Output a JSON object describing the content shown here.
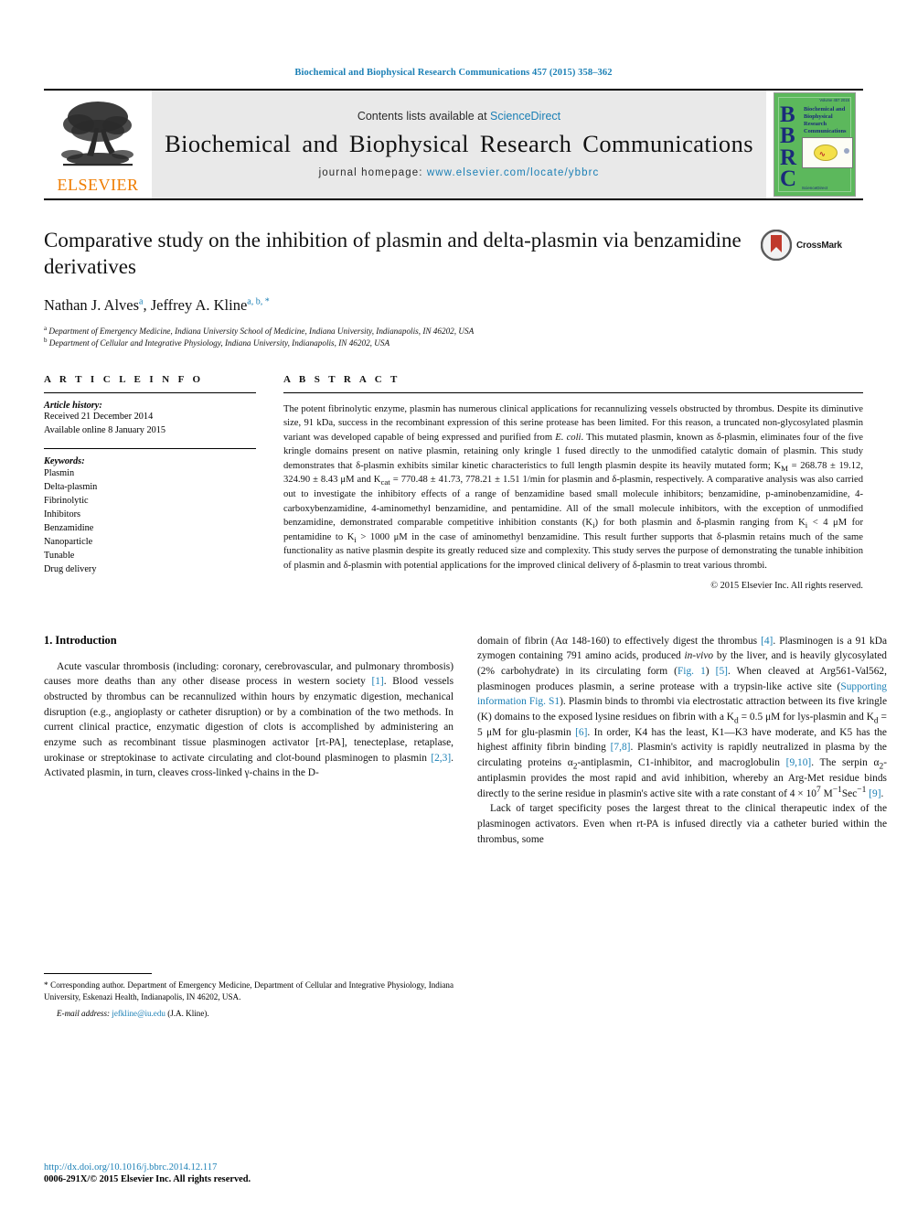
{
  "running_head": "Biochemical and Biophysical Research Communications 457 (2015) 358–362",
  "masthead": {
    "contents_prefix": "Contents lists available at ",
    "sciencedirect": "ScienceDirect",
    "journal_title": "Biochemical and Biophysical Research Communications",
    "homepage_prefix": "journal homepage: ",
    "homepage_url": "www.elsevier.com/locate/ybbrc",
    "publisher": "ELSEVIER",
    "publisher_logo_icon": "elsevier-tree-icon"
  },
  "cover": {
    "letters": "BBRC",
    "journal_name": "Biochemical and Biophysical Research Communications",
    "top_text": "Volume 457  2015",
    "bottom_text": "ScienceDirect"
  },
  "title_block": {
    "title": "Comparative study on the inhibition of plasmin and delta-plasmin via benzamidine derivatives",
    "author_1": "Nathan J. Alves",
    "author_1_marks": "a",
    "author_2": "Jeffrey A. Kline",
    "author_2_marks": "a, b, *",
    "affiliation_a": "Department of Emergency Medicine, Indiana University School of Medicine, Indiana University, Indianapolis, IN 46202, USA",
    "affiliation_b": "Department of Cellular and Integrative Physiology, Indiana University, Indianapolis, IN 46202, USA",
    "crossmark_label": "CrossMark",
    "crossmark_icon": "crossmark-icon"
  },
  "article_info": {
    "heading": "A R T I C L E  I N F O",
    "history_label": "Article history:",
    "received": "Received 21 December 2014",
    "available_online": "Available online 8 January 2015",
    "keywords_label": "Keywords:",
    "keywords": [
      "Plasmin",
      "Delta-plasmin",
      "Fibrinolytic",
      "Inhibitors",
      "Benzamidine",
      "Nanoparticle",
      "Tunable",
      "Drug delivery"
    ]
  },
  "abstract": {
    "heading": "A B S T R A C T",
    "body_1": "The potent fibrinolytic enzyme, plasmin has numerous clinical applications for recannulizing vessels obstructed by thrombus. Despite its diminutive size, 91 kDa, success in the recombinant expression of this serine protease has been limited. For this reason, a truncated non-glycosylated plasmin variant was developed capable of being expressed and purified from ",
    "ecoli": "E. coli",
    "body_2": ". This mutated plasmin, known as δ-plasmin, eliminates four of the five kringle domains present on native plasmin, retaining only kringle 1 fused directly to the unmodified catalytic domain of plasmin. This study demonstrates that δ-plasmin exhibits similar kinetic characteristics to full length plasmin despite its heavily mutated form; K",
    "km_sub": "M",
    "body_3": " = 268.78 ± 19.12, 324.90 ± 8.43 μM and K",
    "kcat_sub": "cat",
    "body_4": " = 770.48 ± 41.73, 778.21 ± 1.51 1/min for plasmin and δ-plasmin, respectively. A comparative analysis was also carried out to investigate the inhibitory effects of a range of benzamidine based small molecule inhibitors; benzamidine, p-aminobenzamidine, 4-carboxybenzamidine, 4-aminomethyl benzamidine, and pentamidine. All of the small molecule inhibitors, with the exception of unmodified benzamidine, demonstrated comparable competitive inhibition constants (K",
    "ki_sub_1": "i",
    "body_5": ") for both plasmin and δ-plasmin ranging from K",
    "ki_sub_2": "i",
    "body_6": " < 4 μM for pentamidine to K",
    "ki_sub_3": "i",
    "body_7": " > 1000 μM in the case of aminomethyl benzamidine. This result further supports that δ-plasmin retains much of the same functionality as native plasmin despite its greatly reduced size and complexity. This study serves the purpose of demonstrating the tunable inhibition of plasmin and δ-plasmin with potential applications for the improved clinical delivery of δ-plasmin to treat various thrombi.",
    "copyright": "© 2015 Elsevier Inc. All rights reserved."
  },
  "introduction": {
    "heading": "1.  Introduction",
    "left_p1_a": "Acute vascular thrombosis (including: coronary, cerebrovascular, and pulmonary thrombosis) causes more deaths than any other disease process in western society ",
    "ref_1": "[1]",
    "left_p1_b": ". Blood vessels obstructed by thrombus can be recannulized within hours by enzymatic digestion, mechanical disruption (e.g., angioplasty or catheter disruption) or by a combination of the two methods. In current clinical practice, enzymatic digestion of clots is accomplished by administering an enzyme such as recombinant tissue plasminogen activator [rt-PA], tenecteplase, retaplase, urokinase or streptokinase to activate circulating and clot-bound plasminogen to plasmin ",
    "ref_23": "[2,3]",
    "left_p1_c": ". Activated plasmin, in turn, cleaves cross-linked γ-chains in the D-",
    "right_p1_a": "domain of fibrin (Aα 148-160) to effectively digest the thrombus ",
    "ref_4": "[4]",
    "right_p1_b": ". Plasminogen is a 91 kDa zymogen containing 791 amino acids, produced ",
    "invivo": "in-vivo",
    "right_p1_c": " by the liver, and is heavily glycosylated (2% carbohydrate) in its circulating form (",
    "fig1_link": "Fig. 1",
    "right_p1_d": ") ",
    "ref_5": "[5]",
    "right_p1_e": ". When cleaved at Arg561-Val562, plasminogen produces plasmin, a serine protease with a trypsin-like active site (",
    "supporting_link": "Supporting information Fig. S1",
    "right_p1_f": "). Plasmin binds to thrombi via electrostatic attraction between its five kringle (K) domains to the exposed lysine residues on fibrin with a K",
    "kd_sub_1": "d",
    "right_p1_g": " = 0.5 μM for lys-plasmin and K",
    "kd_sub_2": "d",
    "right_p1_h": " = 5 μM for glu-plasmin ",
    "ref_6": "[6]",
    "right_p1_i": ". In order, K4 has the least, K1—K3 have moderate, and K5 has the highest affinity fibrin binding ",
    "ref_78": "[7,8]",
    "right_p1_j": ". Plasmin's activity is rapidly neutralized in plasma by the circulating proteins α",
    "alpha_sub_1": "2",
    "right_p1_k": "-antiplasmin, C1-inhibitor, and macroglobulin ",
    "ref_910": "[9,10]",
    "right_p1_l": ". The serpin α",
    "alpha_sub_2": "2",
    "right_p1_m": "-antiplasmin provides the most rapid and avid inhibition, whereby an Arg-Met residue binds directly to the serine residue in plasmin's active site with a rate constant of 4 × 10",
    "exp_7": "7",
    "right_p1_n": " M",
    "exp_m1": "−1",
    "right_p1_o": "Sec",
    "exp_m1b": "−1",
    "right_p1_p": " ",
    "ref_9": "[9]",
    "right_p1_q": ".",
    "right_p2": "Lack of target specificity poses the largest threat to the clinical therapeutic index of the plasminogen activators. Even when rt-PA is infused directly via a catheter buried within the thrombus, some"
  },
  "footnote": {
    "corresponding": "* Corresponding author. Department of Emergency Medicine, Department of Cellular and Integrative Physiology, Indiana University, Eskenazi Health, Indianapolis, IN 46202, USA.",
    "email_label": "E-mail address:",
    "email": "jefkline@iu.edu",
    "email_suffix": "(J.A. Kline)."
  },
  "footer": {
    "doi": "http://dx.doi.org/10.1016/j.bbrc.2014.12.117",
    "issn": "0006-291X/© 2015 Elsevier Inc. All rights reserved."
  },
  "colors": {
    "link_blue": "#1a7fb5",
    "elsevier_orange": "#ef7c00",
    "cover_green": "#5cb85c"
  }
}
